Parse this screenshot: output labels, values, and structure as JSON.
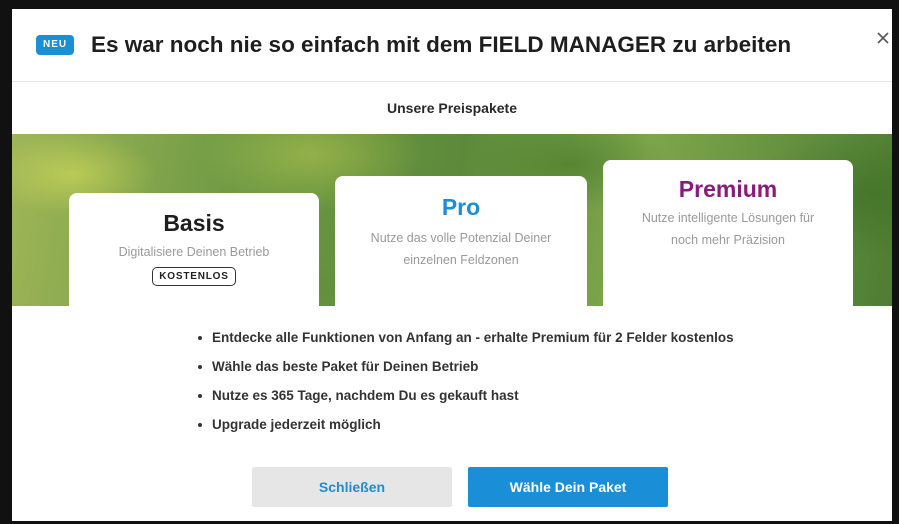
{
  "header": {
    "badge": "NEU",
    "title": "Es war noch nie so einfach mit dem FIELD MANAGER zu arbeiten",
    "close_icon": "close-icon"
  },
  "subheading": "Unsere Preispakete",
  "plans": [
    {
      "name": "Basis",
      "description": "Digitalisiere Deinen Betrieb",
      "tag": "KOSTENLOS",
      "color": "#1e1e1e"
    },
    {
      "name": "Pro",
      "description": "Nutze das volle Potenzial Deiner einzelnen Feldzonen",
      "color": "#1a8fd8"
    },
    {
      "name": "Premium",
      "description": "Nutze intelligente Lösungen für noch mehr Präzision",
      "color": "#8b1a7d"
    }
  ],
  "features": [
    "Entdecke alle Funktionen von Anfang an - erhalte Premium für 2 Felder kostenlos",
    "Wähle das beste Paket für Deinen Betrieb",
    "Nutze es 365 Tage, nachdem Du es gekauft hast",
    "Upgrade jederzeit möglich"
  ],
  "buttons": {
    "close_label": "Schließen",
    "choose_label": "Wähle Dein Paket"
  },
  "colors": {
    "accent": "#1a8fd8",
    "premium": "#8b1a7d",
    "secondary_button": "#e6e6e6"
  }
}
